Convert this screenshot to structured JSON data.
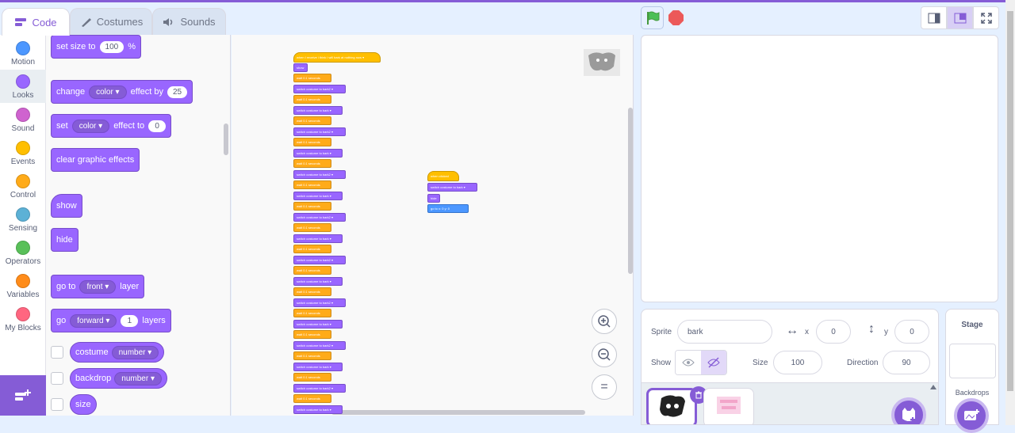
{
  "tabs": [
    {
      "label": "Code",
      "icon": "code-icon",
      "active": true
    },
    {
      "label": "Costumes",
      "icon": "brush-icon",
      "active": false
    },
    {
      "label": "Sounds",
      "icon": "speaker-icon",
      "active": false
    }
  ],
  "categories": [
    {
      "label": "Motion",
      "color": "#4c97ff"
    },
    {
      "label": "Looks",
      "color": "#9966ff",
      "selected": true
    },
    {
      "label": "Sound",
      "color": "#cf63cf"
    },
    {
      "label": "Events",
      "color": "#ffbf00"
    },
    {
      "label": "Control",
      "color": "#ffab19"
    },
    {
      "label": "Sensing",
      "color": "#5cb1d6"
    },
    {
      "label": "Operators",
      "color": "#59c059"
    },
    {
      "label": "Variables",
      "color": "#ff8c1a"
    },
    {
      "label": "My Blocks",
      "color": "#ff6680"
    }
  ],
  "palette": {
    "set_size": {
      "label": "set size to",
      "value": "100",
      "suffix": "%"
    },
    "change_effect": {
      "label": "change",
      "effect": "color",
      "by_label": "effect by",
      "value": "25"
    },
    "set_effect": {
      "label": "set",
      "effect": "color",
      "to_label": "effect to",
      "value": "0"
    },
    "clear_effects": "clear graphic effects",
    "show": "show",
    "hide": "hide",
    "go_to": {
      "label": "go to",
      "option": "front",
      "suffix": "layer"
    },
    "go_layers": {
      "label": "go",
      "option": "forward",
      "value": "1",
      "suffix": "layers"
    },
    "costume_reporter": {
      "label": "costume",
      "option": "number"
    },
    "backdrop_reporter": {
      "label": "backdrop",
      "option": "number"
    },
    "size_reporter": "size"
  },
  "script_main": {
    "hat": "when I receive",
    "hat_option": "i think i will bark at nothing now",
    "show": "show",
    "wait_label": "wait",
    "wait_value": "0.1",
    "seconds": "seconds",
    "switch_label": "switch costume to",
    "costume_a": "bark2",
    "costume_b": "bark"
  },
  "script_flag": {
    "hat": "when clicked",
    "switch_label": "switch costume to",
    "costume": "bark",
    "hide": "hide",
    "goto": "go to x:",
    "x": "0",
    "y_label": "y:",
    "y": "0"
  },
  "sprite_info": {
    "sprite_label": "Sprite",
    "sprite_name": "bark",
    "x_label": "x",
    "x_value": "0",
    "y_label": "y",
    "y_value": "0",
    "show_label": "Show",
    "size_label": "Size",
    "size_value": "100",
    "direction_label": "Direction",
    "direction_value": "90"
  },
  "stage_panel": {
    "title": "Stage",
    "backdrops_label": "Backdrops"
  },
  "colors": {
    "accent": "#855cd6",
    "looks": "#9966ff",
    "control": "#ffab19",
    "events": "#ffbf00",
    "motion": "#4c97ff"
  }
}
